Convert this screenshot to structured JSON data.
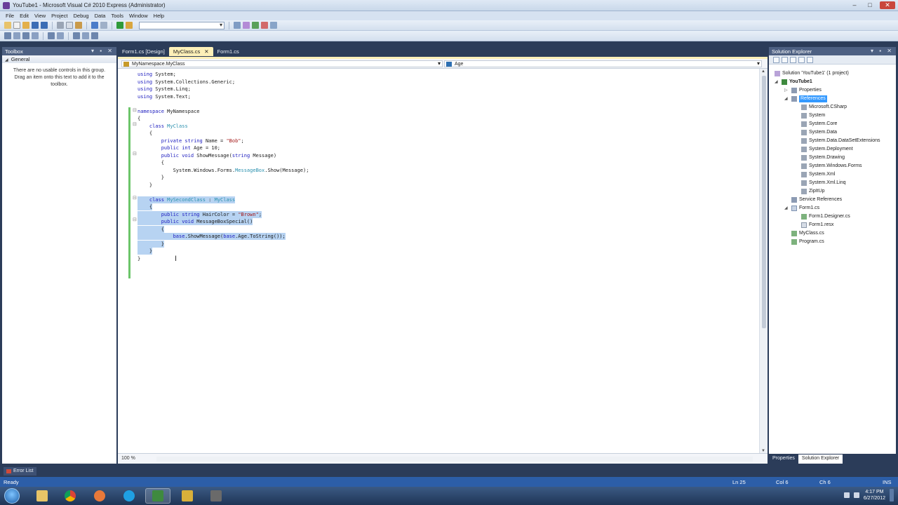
{
  "window": {
    "title": "YouTube1 - Microsoft Visual C# 2010 Express (Administrator)"
  },
  "menu": [
    "File",
    "Edit",
    "View",
    "Project",
    "Debug",
    "Data",
    "Tools",
    "Window",
    "Help"
  ],
  "toolbox": {
    "title": "Toolbox",
    "group": "General",
    "empty_message": "There are no usable controls in this group. Drag an item onto this text to add it to the toolbox."
  },
  "editor": {
    "tabs": [
      {
        "label": "Form1.cs [Design]"
      },
      {
        "label": "MyClass.cs"
      },
      {
        "label": "Form1.cs"
      }
    ],
    "nav_left": "MyNamespace.MyClass",
    "nav_right": "Age",
    "zoom": "100 %",
    "code_lines": [
      "using System;",
      "using System.Collections.Generic;",
      "using System.Linq;",
      "using System.Text;",
      "",
      "namespace MyNamespace",
      "{",
      "    class MyClass",
      "    {",
      "        private string Name = \"Bob\";",
      "        public int Age = 10;",
      "        public void ShowMessage(string Message)",
      "        {",
      "            System.Windows.Forms.MessageBox.Show(Message);",
      "        }",
      "    }",
      "",
      "    class MySecondClass : MyClass",
      "    {",
      "        public string HairColor = \"Brown\";",
      "        public void MessageBoxSpecial()",
      "        {",
      "            base.ShowMessage(base.Age.ToString());",
      "        }",
      "    }",
      "}"
    ]
  },
  "solution_explorer": {
    "title": "Solution Explorer",
    "items": [
      {
        "label": "Solution 'YouTube1' (1 project)"
      },
      {
        "label": "YouTube1"
      },
      {
        "label": "Properties"
      },
      {
        "label": "References"
      },
      {
        "label": "Microsoft.CSharp"
      },
      {
        "label": "System"
      },
      {
        "label": "System.Core"
      },
      {
        "label": "System.Data"
      },
      {
        "label": "System.Data.DataSetExtensions"
      },
      {
        "label": "System.Deployment"
      },
      {
        "label": "System.Drawing"
      },
      {
        "label": "System.Windows.Forms"
      },
      {
        "label": "System.Xml"
      },
      {
        "label": "System.Xml.Linq"
      },
      {
        "label": "ZipItUp"
      },
      {
        "label": "Service References"
      },
      {
        "label": "Form1.cs"
      },
      {
        "label": "Form1.Designer.cs"
      },
      {
        "label": "Form1.resx"
      },
      {
        "label": "MyClass.cs"
      },
      {
        "label": "Program.cs"
      }
    ],
    "tabs": [
      "Properties",
      "Solution Explorer"
    ]
  },
  "bottom_tab": "Error List",
  "status": {
    "ready": "Ready",
    "line": "Ln 25",
    "col": "Col 6",
    "ch": "Ch 6",
    "mode": "INS"
  },
  "clock": {
    "time": "4:17 PM",
    "date": "6/27/2012"
  },
  "colors": {
    "accent": "#2c5ea8",
    "panel_title": "#4d6082",
    "active_tab": "#fdf0b8",
    "selection": "#b7d3f2"
  }
}
